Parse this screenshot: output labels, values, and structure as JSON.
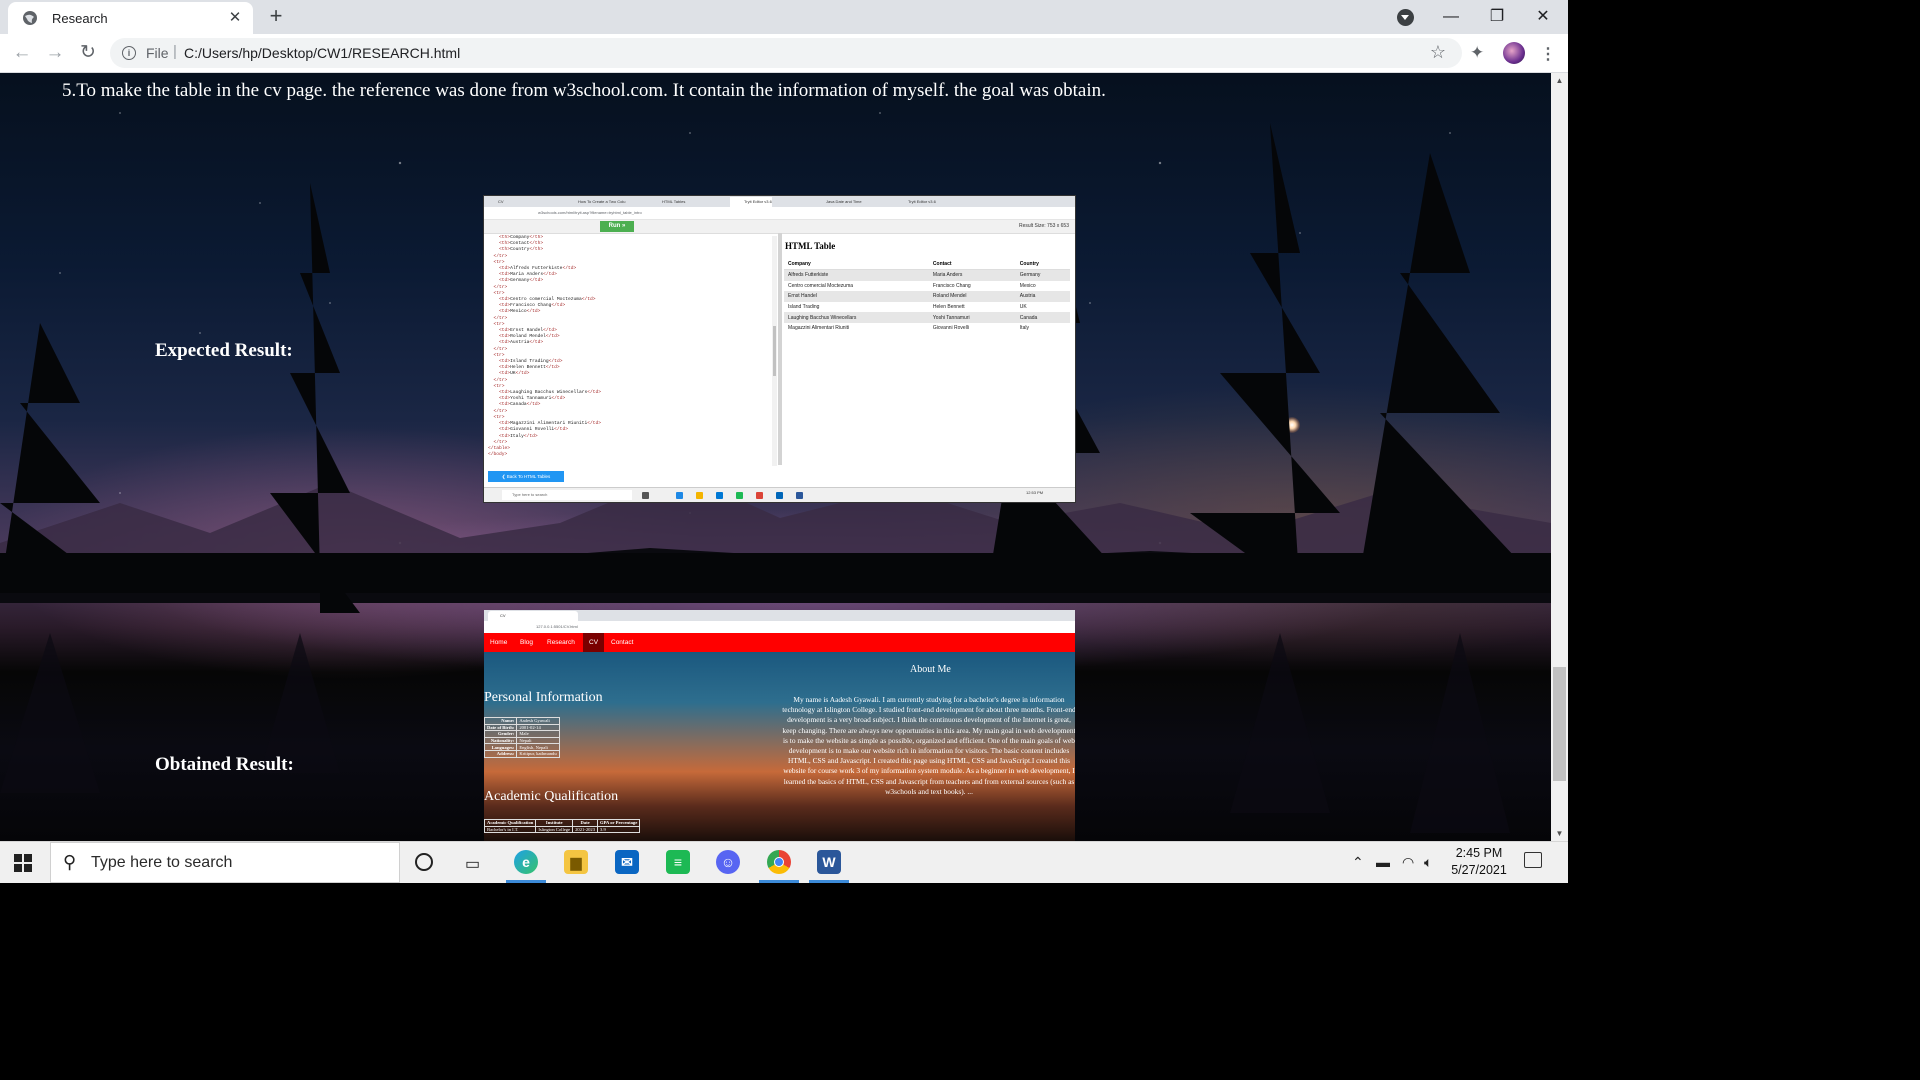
{
  "browser": {
    "tab_title": "Research",
    "url_scheme": "File",
    "url_path": "C:/Users/hp/Desktop/CW1/RESEARCH.html"
  },
  "page": {
    "item_text": "5.To make the table in the cv page. the reference was done from w3school.com. It contain the information of myself. the goal was obtain.",
    "expected_label": "Expected Result:",
    "obtained_label": "Obtained Result:"
  },
  "expected_screenshot": {
    "tabs": [
      "CV",
      "How To Create a Two Colu",
      "HTML Tables",
      "Tryit Editor v3.6",
      "Java Date and Time",
      "Tryit Editor v3.6"
    ],
    "url": "w3schools.com/html/tryit.asp?filename=tryhtml_table_intro",
    "run_label": "Run »",
    "result_size": "Result Size: 753 x 653",
    "code_lines": [
      {
        "tag": "    <th>",
        "text": "Company",
        "close": "</th>"
      },
      {
        "tag": "    <th>",
        "text": "Contact",
        "close": "</th>"
      },
      {
        "tag": "    <th>",
        "text": "Country",
        "close": "</th>"
      },
      {
        "tag": "  </tr>",
        "text": "",
        "close": ""
      },
      {
        "tag": "  <tr>",
        "text": "",
        "close": ""
      },
      {
        "tag": "    <td>",
        "text": "Alfreds Futterkiste",
        "close": "</td>"
      },
      {
        "tag": "    <td>",
        "text": "Maria Anders",
        "close": "</td>"
      },
      {
        "tag": "    <td>",
        "text": "Germany",
        "close": "</td>"
      },
      {
        "tag": "  </tr>",
        "text": "",
        "close": ""
      },
      {
        "tag": "  <tr>",
        "text": "",
        "close": ""
      },
      {
        "tag": "    <td>",
        "text": "Centro comercial Moctezuma",
        "close": "</td>"
      },
      {
        "tag": "    <td>",
        "text": "Francisco Chang",
        "close": "</td>"
      },
      {
        "tag": "    <td>",
        "text": "Mexico",
        "close": "</td>"
      },
      {
        "tag": "  </tr>",
        "text": "",
        "close": ""
      },
      {
        "tag": "  <tr>",
        "text": "",
        "close": ""
      },
      {
        "tag": "    <td>",
        "text": "Ernst Handel",
        "close": "</td>"
      },
      {
        "tag": "    <td>",
        "text": "Roland Mendel",
        "close": "</td>"
      },
      {
        "tag": "    <td>",
        "text": "Austria",
        "close": "</td>"
      },
      {
        "tag": "  </tr>",
        "text": "",
        "close": ""
      },
      {
        "tag": "  <tr>",
        "text": "",
        "close": ""
      },
      {
        "tag": "    <td>",
        "text": "Island Trading",
        "close": "</td>"
      },
      {
        "tag": "    <td>",
        "text": "Helen Bennett",
        "close": "</td>"
      },
      {
        "tag": "    <td>",
        "text": "UK",
        "close": "</td>"
      },
      {
        "tag": "  </tr>",
        "text": "",
        "close": ""
      },
      {
        "tag": "  <tr>",
        "text": "",
        "close": ""
      },
      {
        "tag": "    <td>",
        "text": "Laughing Bacchus Winecellars",
        "close": "</td>"
      },
      {
        "tag": "    <td>",
        "text": "Yoshi Tannamuri",
        "close": "</td>"
      },
      {
        "tag": "    <td>",
        "text": "Canada",
        "close": "</td>"
      },
      {
        "tag": "  </tr>",
        "text": "",
        "close": ""
      },
      {
        "tag": "  <tr>",
        "text": "",
        "close": ""
      },
      {
        "tag": "    <td>",
        "text": "Magazzini Alimentari Riuniti",
        "close": "</td>"
      },
      {
        "tag": "    <td>",
        "text": "Giovanni Rovelli",
        "close": "</td>"
      },
      {
        "tag": "    <td>",
        "text": "Italy",
        "close": "</td>"
      },
      {
        "tag": "  </tr>",
        "text": "",
        "close": ""
      },
      {
        "tag": "</table>",
        "text": "",
        "close": ""
      },
      {
        "tag": "",
        "text": "",
        "close": ""
      },
      {
        "tag": "</body>",
        "text": "",
        "close": ""
      }
    ],
    "result_title": "HTML Table",
    "table_headers": [
      "Company",
      "Contact",
      "Country"
    ],
    "table_rows": [
      [
        "Alfreds Futterkiste",
        "Maria Anders",
        "Germany"
      ],
      [
        "Centro comercial Moctezuma",
        "Francisco Chang",
        "Mexico"
      ],
      [
        "Ernst Handel",
        "Roland Mendel",
        "Austria"
      ],
      [
        "Island Trading",
        "Helen Bennett",
        "UK"
      ],
      [
        "Laughing Bacchus Winecellars",
        "Yoshi Tannamuri",
        "Canada"
      ],
      [
        "Magazzini Alimentari Riuniti",
        "Giovanni Rovelli",
        "Italy"
      ]
    ],
    "back_label": "❮ Back To HTML Tables",
    "taskbar_search": "Type here to search",
    "clock": "12:53 PM"
  },
  "obtained_screenshot": {
    "tab": "CV",
    "url": "127.0.0.1:5501/CV.html",
    "nav": [
      "Home",
      "Blog",
      "Research",
      "CV",
      "Contact"
    ],
    "active_nav": "CV",
    "about_title": "About Me",
    "about_text": "My name is Aadesh Gyawali. I am currently studying for a bachelor's degree in information technology at Islington College. I studied front-end development for about three months. Front-end development is a very broad subject. I think the continuous development of the Internet is great, keep changing. There are always new opportunities in this area. My main goal in web development is to make the website as simple as possible, organized and efficient. One of the main goals of web development is to make our website rich in information for visitors. The basic content includes HTML, CSS and Javascript. I created this page using HTML, CSS and JavaScript.I created this website for course work 3 of my information system module. As a beginner in web development, I learned the basics of HTML, CSS and Javascript from teachers and from external sources (such as w3schools and text books). ...",
    "personal_title": "Personal Information",
    "personal_rows": [
      [
        "Name:",
        "Aadesh Gyawali"
      ],
      [
        "Date of Birth:",
        "2001-02-14"
      ],
      [
        "Gender:",
        "Male"
      ],
      [
        "Nationality:",
        "Nepali"
      ],
      [
        "Languages:",
        "English, Nepali"
      ],
      [
        "Address:",
        "Kritipur, kathmandu"
      ]
    ],
    "academic_title": "Academic Qualification",
    "academic_headers": [
      "Academic Qualification",
      "Institute",
      "Date",
      "GPA or Percentage"
    ],
    "academic_rows": [
      [
        "Bachelor's in I.T.",
        "Islington College",
        "2021-2023",
        "3.9"
      ]
    ]
  },
  "taskbar": {
    "search_placeholder": "Type here to search",
    "time": "2:45 PM",
    "date": "5/27/2021"
  }
}
